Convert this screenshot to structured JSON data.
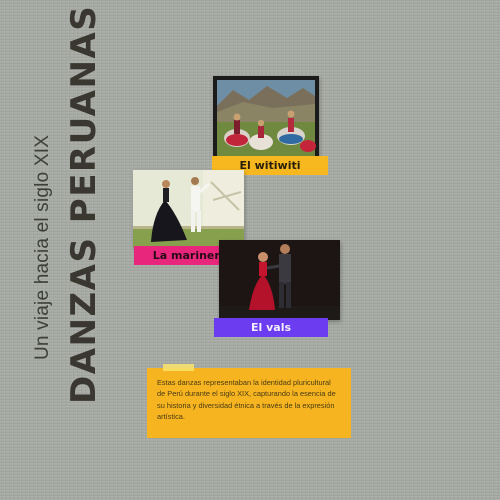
{
  "subtitle": "Un viaje hacia el siglo XIX",
  "title": "DANZAS PERUANAS",
  "photos": [
    {
      "label": "El witiwiti",
      "label_bg": "#f6b81e",
      "label_color": "#2a1f0a"
    },
    {
      "label": "La marinera",
      "label_bg": "#e8277c",
      "label_color": "#2a0a18"
    },
    {
      "label": "El vals",
      "label_bg": "#6b3cf0",
      "label_color": "#f3eefe"
    }
  ],
  "note": "Estas danzas representaban la identidad pluricultural de Perú durante el siglo XIX, capturando la esencia de su historia y diversidad étnica a través de la expresión artística."
}
